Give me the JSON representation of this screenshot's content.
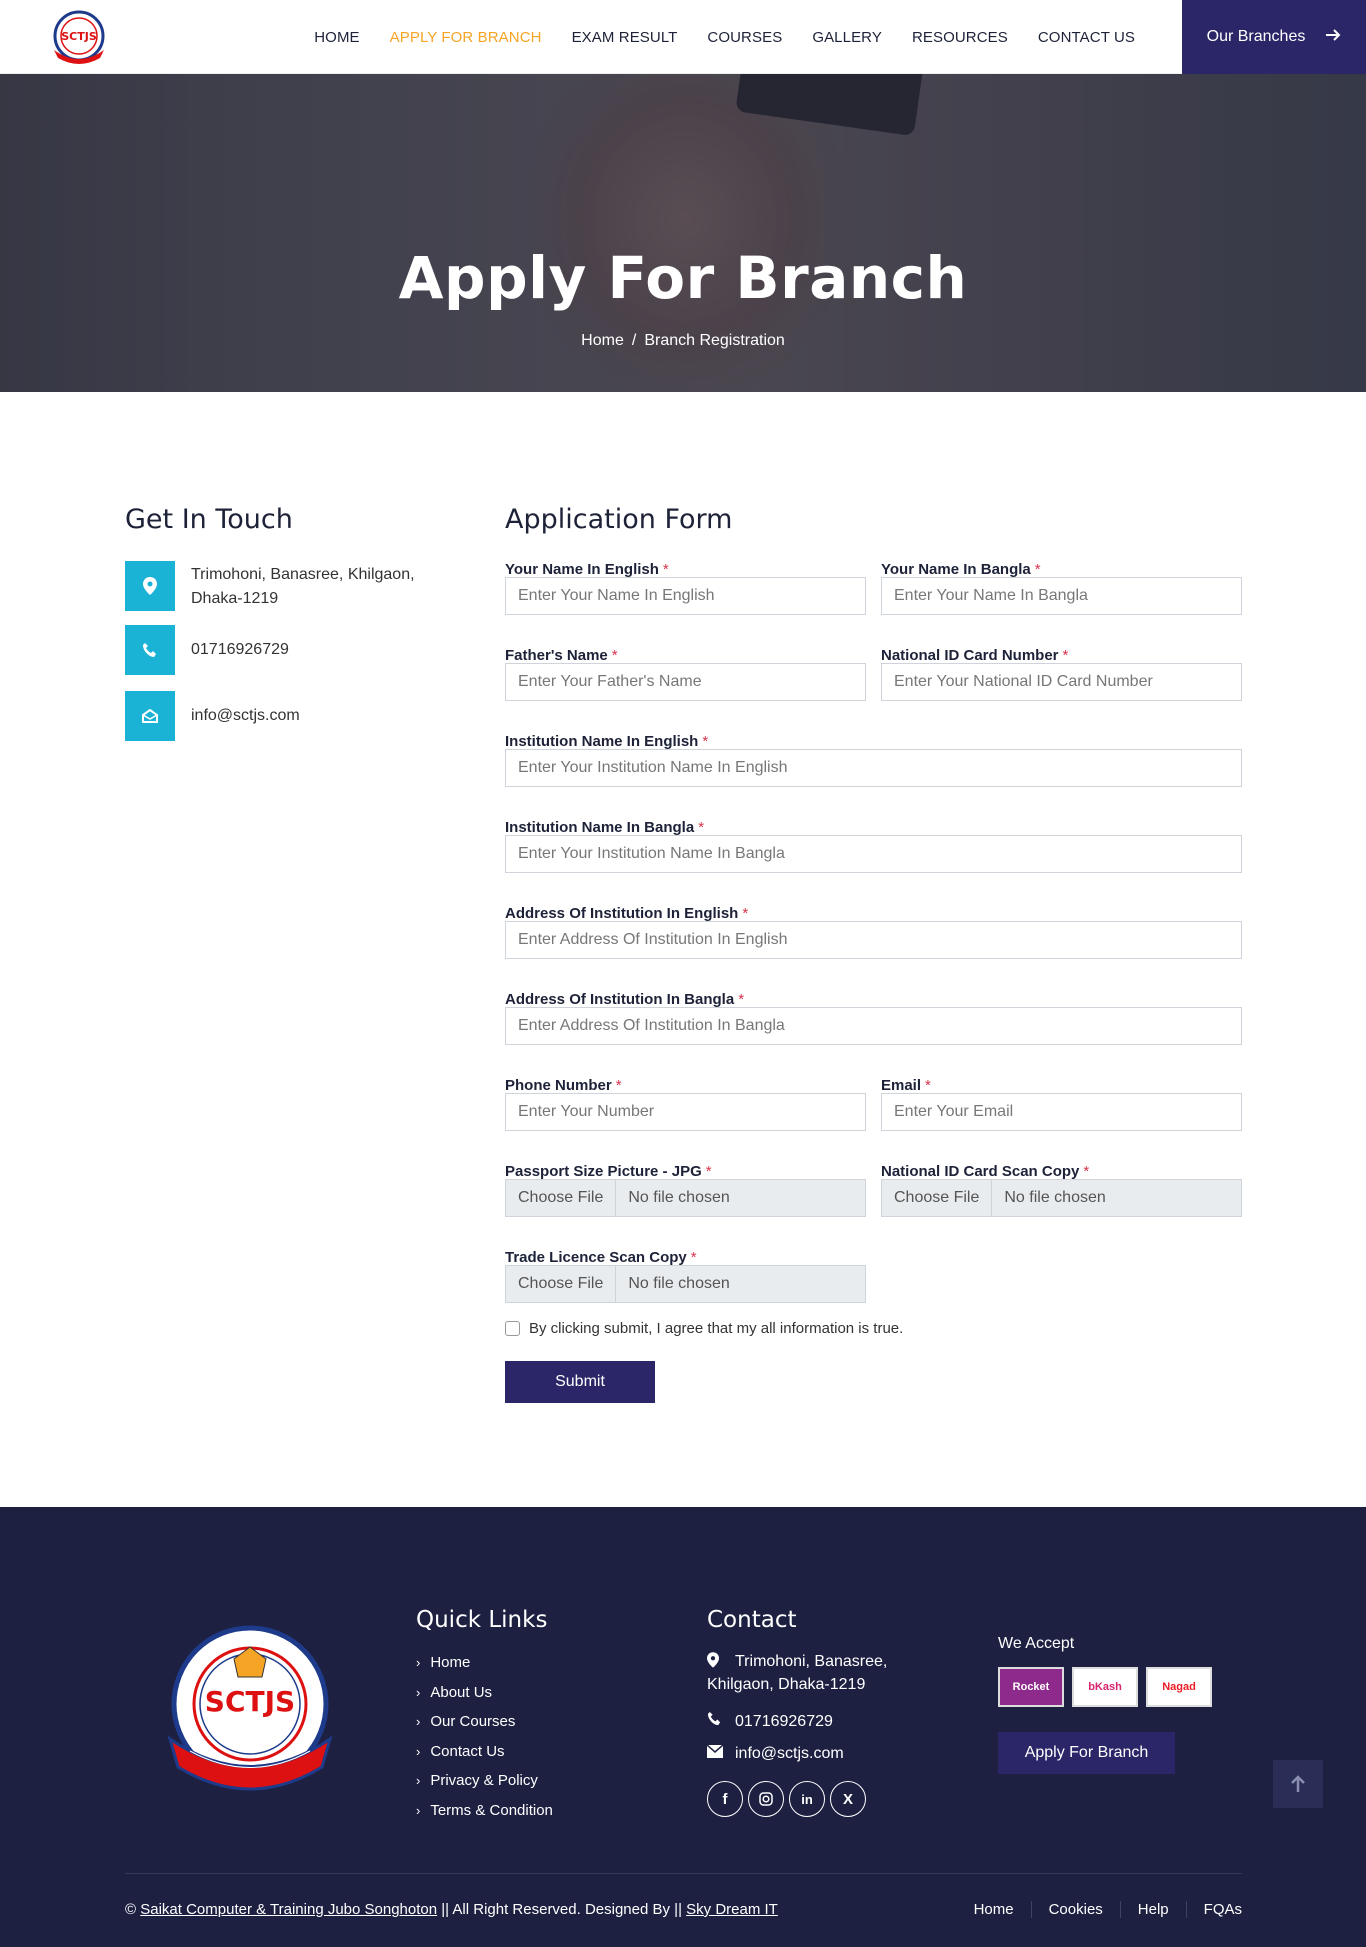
{
  "header": {
    "logo_text": "SCTJS",
    "nav": [
      {
        "label": "HOME"
      },
      {
        "label": "APPLY FOR BRANCH"
      },
      {
        "label": "EXAM RESULT"
      },
      {
        "label": "COURSES"
      },
      {
        "label": "GALLERY"
      },
      {
        "label": "RESOURCES"
      },
      {
        "label": "CONTACT US"
      }
    ],
    "branches_button": "Our Branches"
  },
  "hero": {
    "title": "Apply For Branch",
    "breadcrumb_home": "Home",
    "breadcrumb_sep": "/",
    "breadcrumb_current": "Branch Registration"
  },
  "touch": {
    "title": "Get In Touch",
    "address": "Trimohoni, Banasree, Khilgaon, Dhaka-1219",
    "phone": "01716926729",
    "email": "info@sctjs.com"
  },
  "form": {
    "title": "Application Form",
    "fields": {
      "name_en": {
        "label": "Your Name In English",
        "placeholder": "Enter Your Name In English"
      },
      "name_bn": {
        "label": "Your Name In Bangla",
        "placeholder": "Enter Your Name In Bangla"
      },
      "father": {
        "label": "Father's Name",
        "placeholder": "Enter Your Father's Name"
      },
      "nid": {
        "label": "National ID Card Number",
        "placeholder": "Enter Your National ID Card Number"
      },
      "inst_en": {
        "label": "Institution Name In English",
        "placeholder": "Enter Your Institution Name In English"
      },
      "inst_bn": {
        "label": "Institution Name In Bangla",
        "placeholder": "Enter Your Institution Name In Bangla"
      },
      "addr_en": {
        "label": "Address Of Institution In English",
        "placeholder": "Enter Address Of Institution In English"
      },
      "addr_bn": {
        "label": "Address Of Institution In Bangla",
        "placeholder": "Enter Address Of Institution In Bangla"
      },
      "phone": {
        "label": "Phone Number",
        "placeholder": "Enter Your Number"
      },
      "email": {
        "label": "Email",
        "placeholder": "Enter Your Email"
      },
      "photo": {
        "label": "Passport Size Picture - JPG"
      },
      "nid_scan": {
        "label": "National ID Card Scan Copy"
      },
      "trade": {
        "label": "Trade Licence Scan Copy"
      }
    },
    "required_mark": "*",
    "file_choose": "Choose File",
    "file_none": "No file chosen",
    "agree_text": "By clicking submit, I agree that my all information is true.",
    "submit": "Submit"
  },
  "footer": {
    "quick_links_title": "Quick Links",
    "quick_links": [
      "Home",
      "About Us",
      "Our Courses",
      "Contact Us",
      "Privacy & Policy",
      "Terms & Condition"
    ],
    "contact_title": "Contact",
    "contact_address": "Trimohoni, Banasree, Khilgaon, Dhaka-1219",
    "contact_phone": "01716926729",
    "contact_email": "info@sctjs.com",
    "accept_title": "We Accept",
    "payments": [
      "Rocket",
      "bKash",
      "Nagad"
    ],
    "apply_button": "Apply For Branch",
    "copyright_prefix": "©",
    "copyright_org": "Saikat Computer & Training Jubo Songhoton",
    "copyright_mid": "|| All Right Reserved. Designed By ||",
    "copyright_designer": "Sky Dream IT",
    "bottom_nav": [
      "Home",
      "Cookies",
      "Help",
      "FQAs"
    ]
  },
  "colors": {
    "accent": "#f5a425",
    "primary": "#2b2667",
    "cyan": "#1ab3d6",
    "footer_bg": "#1d2041",
    "required": "#d9334b"
  }
}
